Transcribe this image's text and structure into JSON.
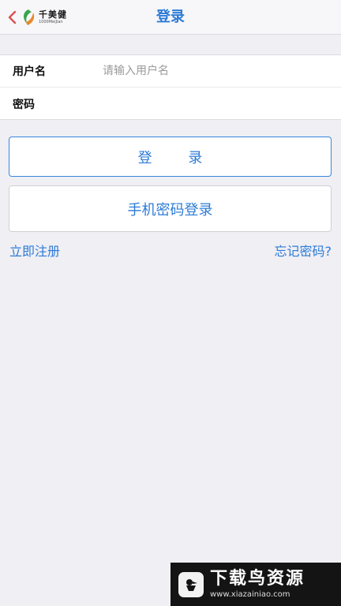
{
  "navbar": {
    "back_icon": "chevron-left-icon",
    "logo": {
      "name": "千美健",
      "sub": "1000MeiJian"
    },
    "title": "登录"
  },
  "form": {
    "username_label": "用户名",
    "username_placeholder": "请输入用户名",
    "username_value": "",
    "password_label": "密码",
    "password_value": ""
  },
  "buttons": {
    "login": "登 录",
    "phone_login": "手机密码登录"
  },
  "links": {
    "register": "立即注册",
    "forgot": "忘记密码?"
  },
  "watermark": {
    "title": "下载鸟资源",
    "url": "www.xiazainiao.com"
  },
  "colors": {
    "accent": "#2d7bd6",
    "background": "#efeff4",
    "logo_green": "#3aa54a",
    "logo_orange": "#e8892a",
    "back_red": "#d9534f"
  }
}
